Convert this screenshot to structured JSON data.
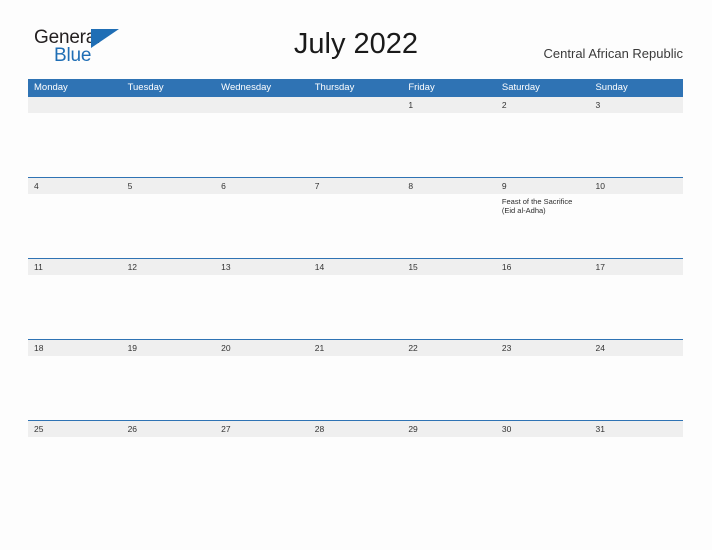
{
  "brand": {
    "name_top": "General",
    "name_bottom": "Blue",
    "triangle_icon": "triangle-icon",
    "color_primary": "#1f6eb5"
  },
  "header": {
    "title": "July 2022",
    "country": "Central African Republic"
  },
  "theme": {
    "header_blue": "#2f73b4",
    "strip_gray": "#efefef",
    "text_dark": "#333333",
    "page_background": "#fdfdfd"
  },
  "calendar": {
    "month": "July",
    "year": "2022",
    "day_headers": [
      "Monday",
      "Tuesday",
      "Wednesday",
      "Thursday",
      "Friday",
      "Saturday",
      "Sunday"
    ],
    "weeks": [
      {
        "days": [
          {
            "date": "",
            "events": []
          },
          {
            "date": "",
            "events": []
          },
          {
            "date": "",
            "events": []
          },
          {
            "date": "",
            "events": []
          },
          {
            "date": "1",
            "events": []
          },
          {
            "date": "2",
            "events": []
          },
          {
            "date": "3",
            "events": []
          }
        ]
      },
      {
        "days": [
          {
            "date": "4",
            "events": []
          },
          {
            "date": "5",
            "events": []
          },
          {
            "date": "6",
            "events": []
          },
          {
            "date": "7",
            "events": []
          },
          {
            "date": "8",
            "events": []
          },
          {
            "date": "9",
            "events": [
              "Feast of the Sacrifice (Eid al-Adha)"
            ]
          },
          {
            "date": "10",
            "events": []
          }
        ]
      },
      {
        "days": [
          {
            "date": "11",
            "events": []
          },
          {
            "date": "12",
            "events": []
          },
          {
            "date": "13",
            "events": []
          },
          {
            "date": "14",
            "events": []
          },
          {
            "date": "15",
            "events": []
          },
          {
            "date": "16",
            "events": []
          },
          {
            "date": "17",
            "events": []
          }
        ]
      },
      {
        "days": [
          {
            "date": "18",
            "events": []
          },
          {
            "date": "19",
            "events": []
          },
          {
            "date": "20",
            "events": []
          },
          {
            "date": "21",
            "events": []
          },
          {
            "date": "22",
            "events": []
          },
          {
            "date": "23",
            "events": []
          },
          {
            "date": "24",
            "events": []
          }
        ]
      },
      {
        "days": [
          {
            "date": "25",
            "events": []
          },
          {
            "date": "26",
            "events": []
          },
          {
            "date": "27",
            "events": []
          },
          {
            "date": "28",
            "events": []
          },
          {
            "date": "29",
            "events": []
          },
          {
            "date": "30",
            "events": []
          },
          {
            "date": "31",
            "events": []
          }
        ]
      }
    ]
  }
}
